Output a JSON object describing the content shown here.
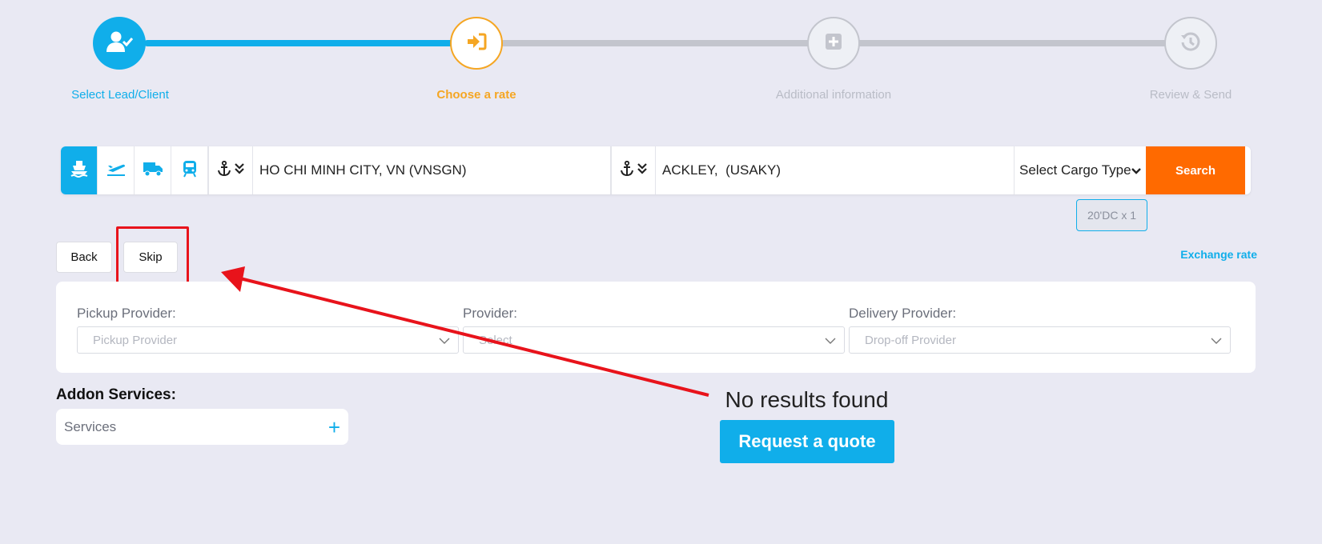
{
  "stepper": {
    "steps": [
      {
        "label": "Select Lead/Client",
        "state": "done"
      },
      {
        "label": "Choose a rate",
        "state": "active"
      },
      {
        "label": "Additional information",
        "state": "todo"
      },
      {
        "label": "Review & Send",
        "state": "todo"
      }
    ]
  },
  "search": {
    "modes": [
      "ship-icon",
      "plane-icon",
      "truck-icon",
      "train-icon"
    ],
    "active_mode": "ship-icon",
    "origin_value": "HO CHI MINH CITY, VN (VNSGN)",
    "destination_value": "ACKLEY,  (USAKY)",
    "cargo_type": "Select Cargo Type",
    "search_label": "Search",
    "container_chip": "20'DC x 1"
  },
  "actions": {
    "back_label": "Back",
    "skip_label": "Skip",
    "exchange_rate_label": "Exchange rate"
  },
  "filters": {
    "pickup": {
      "label": "Pickup Provider:",
      "placeholder": "Pickup Provider"
    },
    "provider": {
      "label": "Provider:",
      "placeholder": "Select"
    },
    "delivery": {
      "label": "Delivery Provider:",
      "placeholder": "Drop-off Provider"
    }
  },
  "addons": {
    "title": "Addon Services:",
    "services_label": "Services"
  },
  "results": {
    "empty_text": "No results found",
    "request_quote_label": "Request a quote"
  },
  "colors": {
    "primary": "#10aeea",
    "active_step": "#f5a623",
    "search_button": "#ff6a00",
    "annotation": "#e8131b"
  }
}
